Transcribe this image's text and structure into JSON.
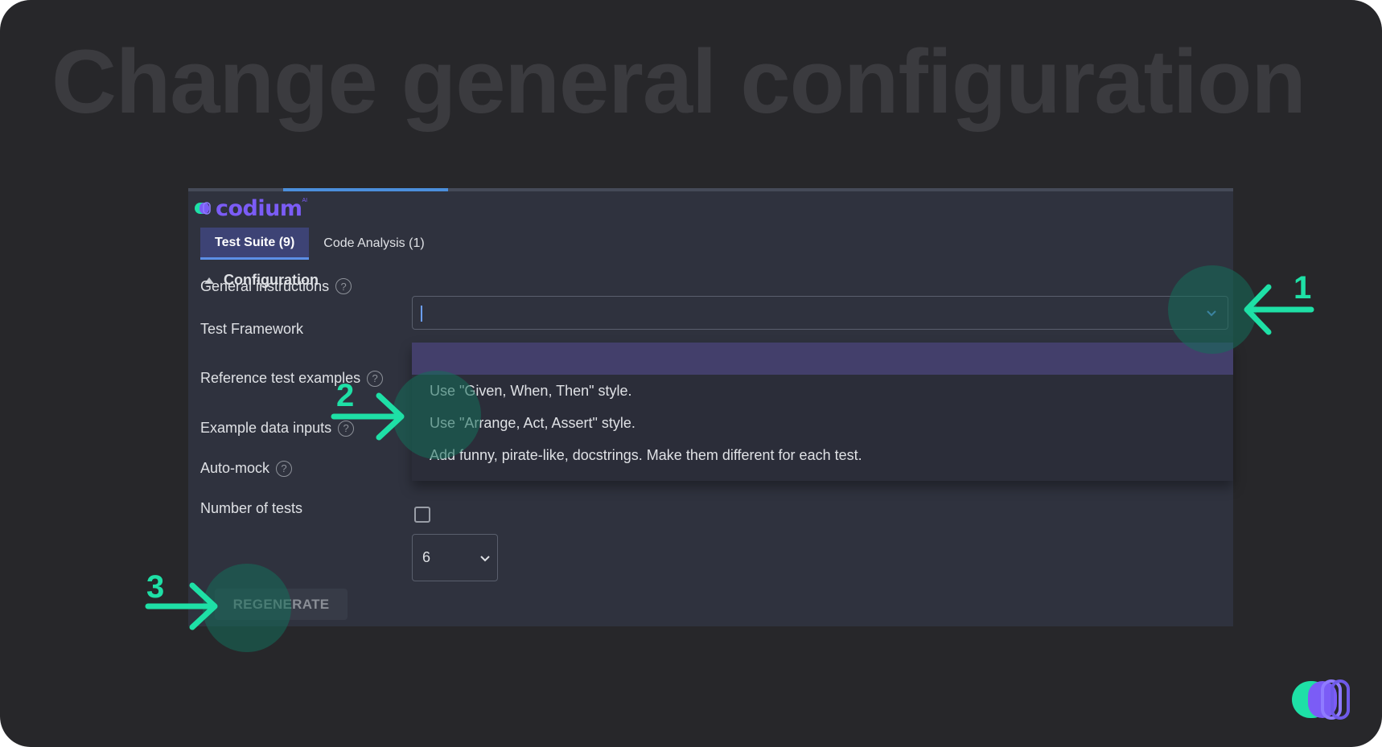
{
  "headline": "Change general configuration",
  "brand": {
    "name": "codium",
    "tm": "AI"
  },
  "tabs": [
    {
      "label": "Test Suite (9)",
      "active": true
    },
    {
      "label": "Code Analysis (1)",
      "active": false
    }
  ],
  "section": {
    "title": "Configuration"
  },
  "fields": {
    "general_instructions": {
      "label": "General instructions",
      "value": ""
    },
    "test_framework": {
      "label": "Test Framework"
    },
    "reference_tests": {
      "label": "Reference test examples"
    },
    "example_inputs": {
      "label": "Example data inputs"
    },
    "auto_mock": {
      "label": "Auto-mock",
      "checked": false
    },
    "num_tests": {
      "label": "Number of tests",
      "value": "6"
    }
  },
  "dropdown": {
    "options": [
      "",
      "Use \"Given, When, Then\" style.",
      "Use \"Arrange, Act, Assert\" style.",
      "Add funny, pirate-like, docstrings. Make them different for each test."
    ],
    "highlighted_index": 0
  },
  "buttons": {
    "regenerate": "REGENERATE"
  },
  "help_glyph": "?",
  "annotations": {
    "step1": "1",
    "step2": "2",
    "step3": "3"
  },
  "colors": {
    "background": "#27272a",
    "panel": "#2f323e",
    "accent_green": "#1ee0a6",
    "brand_purple": "#7b5cf6",
    "tab_active": "#3d4375",
    "dropdown_highlight": "#433f6b"
  }
}
